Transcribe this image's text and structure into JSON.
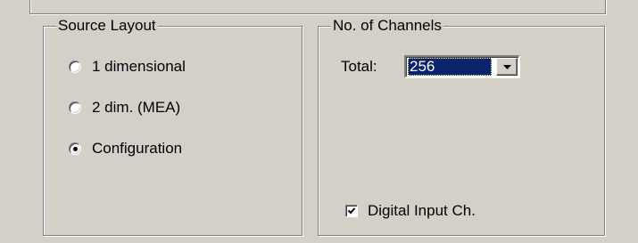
{
  "source_layout": {
    "title": "Source Layout",
    "options": [
      {
        "label": "1 dimensional",
        "selected": false
      },
      {
        "label": "2 dim. (MEA)",
        "selected": false
      },
      {
        "label": "Configuration",
        "selected": true
      }
    ]
  },
  "channels": {
    "title": "No. of Channels",
    "total_label": "Total:",
    "total_value": "256",
    "digital_input_label": "Digital Input Ch.",
    "digital_input_checked": true
  },
  "colors": {
    "dialog_background": "#d4d0c8",
    "selection_highlight": "#0a246a"
  },
  "icons": {
    "dropdown": "chevron-down-icon",
    "check": "checkmark-icon"
  }
}
